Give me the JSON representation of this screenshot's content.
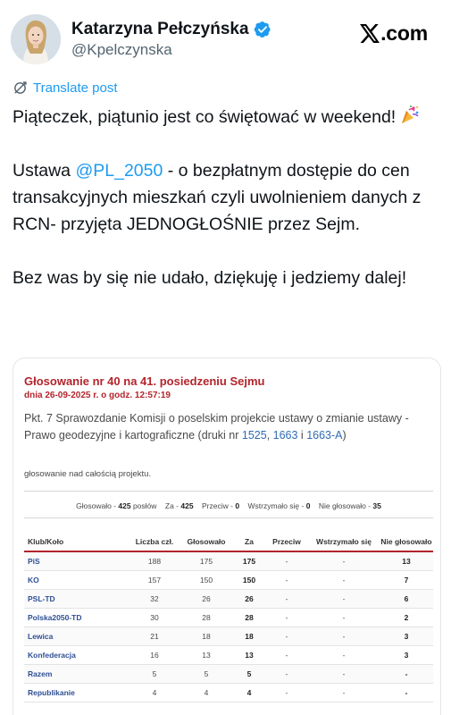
{
  "author": {
    "display_name": "Katarzyna Pełczyńska",
    "handle": "@Kpelczynska",
    "verified_icon": "verified-badge-icon",
    "avatar_icon": "avatar-photo"
  },
  "brand": {
    "logo_icon": "x-logo-icon",
    "domain_text": ".com"
  },
  "translate": {
    "label": "Translate post",
    "icon": "translate-icon"
  },
  "post": {
    "line1": "Piąteczek, piątunio  jest co świętować w weekend!",
    "line1_emoji_icon": "party-popper-icon",
    "p2_before": "Ustawa ",
    "p2_mention": "@PL_2050",
    "p2_after": " - o bezpłatnym dostępie do cen transakcyjnych mieszkań czyli uwolnieniem danych z RCN- przyjęta JEDNOGŁOŚNIE przez Sejm.",
    "p3": "Bez was by się nie udało, dziękuję i jedziemy dalej!"
  },
  "vote_image": {
    "title": "Głosowanie nr 40 na 41. posiedzeniu Sejmu",
    "date": "dnia 26-09-2025 r. o godz. 12:57:19",
    "desc_before": "Pkt. 7 Sprawozdanie Komisji o poselskim projekcie ustawy o zmianie ustawy - Prawo geodezyjne i kartograficzne (druki nr ",
    "desc_link1": "1525",
    "desc_sep1": ", ",
    "desc_link2": "1663",
    "desc_sep2": " i ",
    "desc_link3": "1663-A",
    "desc_after": ")",
    "subtitle": "głosowanie nad całością projektu.",
    "summary": {
      "glosowalo_label": "Głosowało -",
      "glosowalo_value": "425",
      "glosowalo_unit": "posłów",
      "za_label": "Za -",
      "za_value": "425",
      "przeciw_label": "Przeciw -",
      "przeciw_value": "0",
      "wstrzymalo_label": "Wstrzymało się -",
      "wstrzymalo_value": "0",
      "nie_glosowalo_label": "Nie głosowało -",
      "nie_glosowalo_value": "35"
    },
    "columns": [
      "Klub/Koło",
      "Liczba czł.",
      "Głosowało",
      "Za",
      "Przeciw",
      "Wstrzymało się",
      "Nie głosowało"
    ],
    "rows": [
      [
        "PiS",
        "188",
        "175",
        "175",
        "-",
        "-",
        "13"
      ],
      [
        "KO",
        "157",
        "150",
        "150",
        "-",
        "-",
        "7"
      ],
      [
        "PSL-TD",
        "32",
        "26",
        "26",
        "-",
        "-",
        "6"
      ],
      [
        "Polska2050-TD",
        "30",
        "28",
        "28",
        "-",
        "-",
        "2"
      ],
      [
        "Lewica",
        "21",
        "18",
        "18",
        "-",
        "-",
        "3"
      ],
      [
        "Konfederacja",
        "16",
        "13",
        "13",
        "-",
        "-",
        "3"
      ],
      [
        "Razem",
        "5",
        "5",
        "5",
        "-",
        "-",
        "-"
      ],
      [
        "Republikanie",
        "4",
        "4",
        "4",
        "-",
        "-",
        "-"
      ]
    ]
  },
  "colors": {
    "link_blue": "#1d9bf0",
    "sejm_red": "#b3242b",
    "club_blue": "#2e4f94"
  }
}
